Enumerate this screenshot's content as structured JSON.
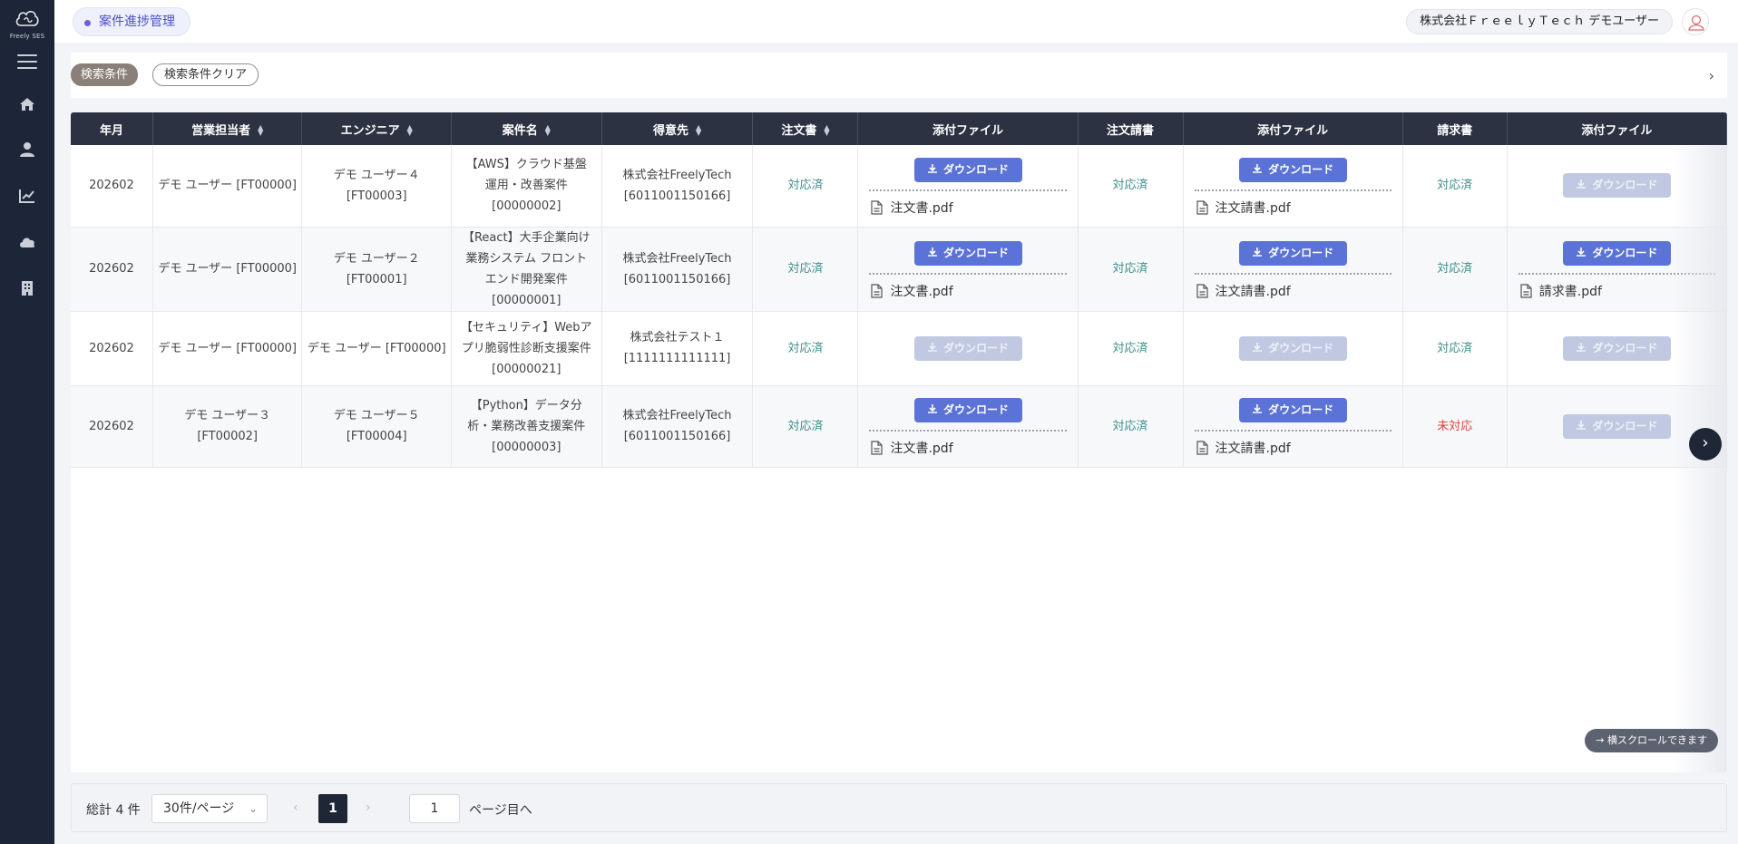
{
  "app": {
    "logo_text": "Freely SES"
  },
  "header": {
    "page_title": "案件進捗管理",
    "user_label": "株式会社ＦｒｅｅｌｙＴｅｃｈ デモユーザー"
  },
  "search": {
    "search_label": "検索条件",
    "clear_label": "検索条件クリア"
  },
  "table": {
    "columns": [
      "年月",
      "営業担当者",
      "エンジニア",
      "案件名",
      "得意先",
      "注文書",
      "添付ファイル",
      "注文請書",
      "添付ファイル",
      "請求書",
      "添付ファイル"
    ],
    "download_label": "ダウンロード",
    "rows": [
      {
        "month": "202602",
        "sales": "デモ ユーザー [FT00000]",
        "engineer": "デモ ユーザー４\n[FT00003]",
        "project": "【AWS】クラウド基盤 運用・改善案件 [00000002]",
        "client": "株式会社FreelyTech\n[6011001150166]",
        "order_status": "対応済",
        "order_file": "注文書.pdf",
        "acceptance_status": "対応済",
        "acceptance_file": "注文請書.pdf",
        "invoice_status": "対応済",
        "invoice_file": ""
      },
      {
        "month": "202602",
        "sales": "デモ ユーザー [FT00000]",
        "engineer": "デモ ユーザー２\n[FT00001]",
        "project": "【React】大手企業向け業務システム フロントエンド開発案件 [00000001]",
        "client": "株式会社FreelyTech\n[6011001150166]",
        "order_status": "対応済",
        "order_file": "注文書.pdf",
        "acceptance_status": "対応済",
        "acceptance_file": "注文請書.pdf",
        "invoice_status": "対応済",
        "invoice_file": "請求書.pdf"
      },
      {
        "month": "202602",
        "sales": "デモ ユーザー [FT00000]",
        "engineer": "デモ ユーザー [FT00000]",
        "project": "【セキュリティ】Webアプリ脆弱性診断支援案件 [00000021]",
        "client": "株式会社テスト１\n[1111111111111]",
        "order_status": "対応済",
        "order_file": "",
        "acceptance_status": "対応済",
        "acceptance_file": "",
        "invoice_status": "対応済",
        "invoice_file": ""
      },
      {
        "month": "202602",
        "sales": "デモ ユーザー３\n[FT00002]",
        "engineer": "デモ ユーザー５\n[FT00004]",
        "project": "【Python】データ分析・業務改善支援案件 [00000003]",
        "client": "株式会社FreelyTech\n[6011001150166]",
        "order_status": "対応済",
        "order_file": "注文書.pdf",
        "acceptance_status": "対応済",
        "acceptance_file": "注文請書.pdf",
        "invoice_status": "未対応",
        "invoice_file": ""
      }
    ],
    "scroll_hint": "→ 横スクロールできます"
  },
  "pagination": {
    "total": "総計 4 件",
    "page_size": "30件/ページ",
    "current_page": "1",
    "goto_value": "1",
    "goto_label": "ページ目へ"
  }
}
